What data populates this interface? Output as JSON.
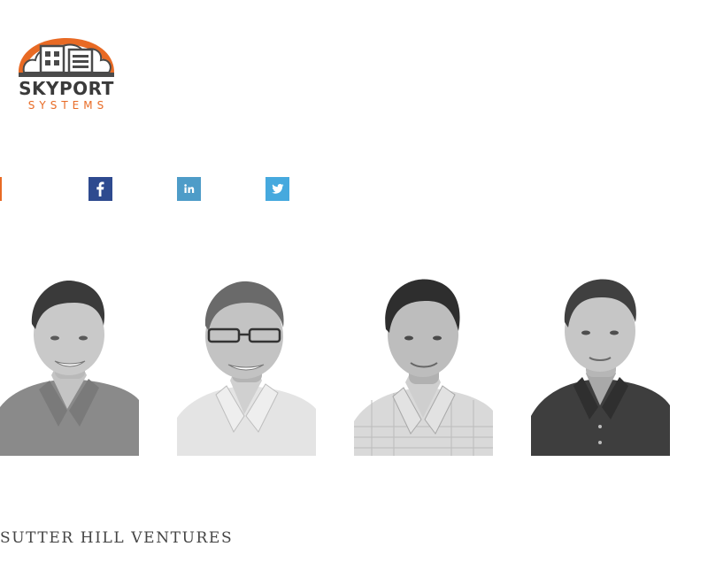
{
  "logo": {
    "name": "SKYPORT",
    "tagline": "SYSTEMS",
    "colors": {
      "arc": "#e86a24",
      "buildings": "#4a4a4a"
    }
  },
  "social": [
    {
      "icon": "facebook-icon",
      "glyph": "f",
      "color": "#2e4a8f"
    },
    {
      "icon": "linkedin-icon",
      "glyph": "in",
      "color": "#4e9cc8"
    },
    {
      "icon": "twitter-icon",
      "glyph": "bird",
      "color": "#46a9de"
    }
  ],
  "team_photos": [
    {
      "icon": "person-photo"
    },
    {
      "icon": "person-photo"
    },
    {
      "icon": "person-photo"
    },
    {
      "icon": "person-photo"
    }
  ],
  "investor": {
    "name": "SUTTER HILL VENTURES"
  }
}
